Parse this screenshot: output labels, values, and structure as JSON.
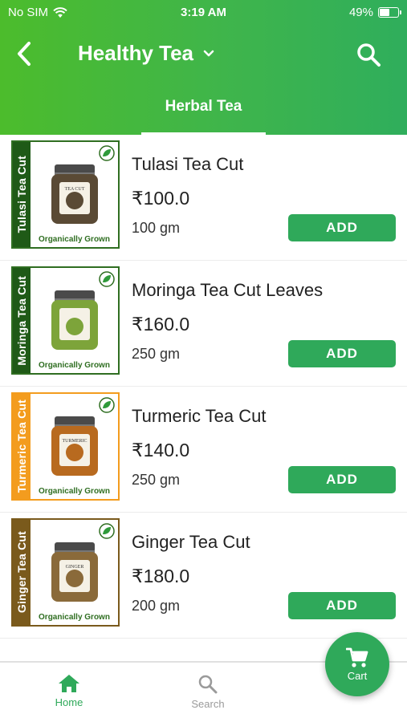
{
  "status_bar": {
    "carrier": "No SIM",
    "time": "3:19 AM",
    "battery": "49%",
    "battery_level": 0.49
  },
  "header": {
    "title": "Healthy Tea",
    "back_icon": "chevron-left-icon",
    "dropdown_icon": "chevron-down-icon",
    "search_icon": "search-icon"
  },
  "tabs": [
    {
      "label": "Herbal Tea",
      "active": true
    }
  ],
  "products": [
    {
      "name": "Tulasi Tea Cut",
      "price": "₹100.0",
      "weight": "100 gm",
      "add_label": "ADD",
      "strip_text": "Tulasi Tea Cut",
      "badge_text": "Organically Grown",
      "jar_label": "TEA CUT",
      "strip_color": "#1f5a17",
      "fill_color": "#5a4a35",
      "border_color": "#2f6e21"
    },
    {
      "name": "Moringa Tea Cut Leaves",
      "price": "₹160.0",
      "weight": "250 gm",
      "add_label": "ADD",
      "strip_text": "Moringa Tea Cut",
      "badge_text": "Organically Grown",
      "jar_label": "",
      "strip_color": "#1f5a17",
      "fill_color": "#7da43a",
      "border_color": "#2f6e21"
    },
    {
      "name": "Turmeric Tea Cut",
      "price": "₹140.0",
      "weight": "250 gm",
      "add_label": "ADD",
      "strip_text": "Turmeric Tea Cut",
      "badge_text": "Organically Grown",
      "jar_label": "TURMERIC",
      "strip_color": "#f39c1e",
      "fill_color": "#b86a1f",
      "border_color": "#f39c1e"
    },
    {
      "name": "Ginger Tea Cut",
      "price": "₹180.0",
      "weight": "200 gm",
      "add_label": "ADD",
      "strip_text": "Ginger Tea Cut",
      "badge_text": "Organically Grown",
      "jar_label": "GINGER",
      "strip_color": "#7a5a1c",
      "fill_color": "#8a6a3a",
      "border_color": "#7a5a1c"
    }
  ],
  "bottom_nav": {
    "home_label": "Home",
    "search_label": "Search",
    "cart_label": "Cart"
  },
  "colors": {
    "accent": "#2fa95a",
    "header_start": "#4cbc2c",
    "header_end": "#2fae5c"
  }
}
